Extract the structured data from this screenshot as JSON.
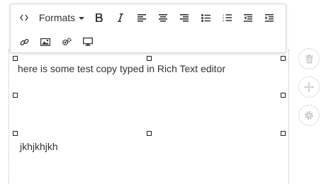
{
  "toolbar": {
    "formats_label": "Formats",
    "buttons": [
      "source-code",
      "formats",
      "bold",
      "italic",
      "align-left",
      "align-center",
      "align-right",
      "bullet-list",
      "numbered-list",
      "outdent",
      "indent",
      "link",
      "image",
      "settings",
      "preview"
    ]
  },
  "editor": {
    "line1": "here is some test copy typed in Rich Text editor",
    "line2": "jkhjkhjkh"
  },
  "side_actions": [
    "trash-icon",
    "move-icon",
    "gear-icon"
  ],
  "colors": {
    "icon": "#333333",
    "side_icon": "#c8c8c8",
    "border": "#d9d9d9"
  }
}
